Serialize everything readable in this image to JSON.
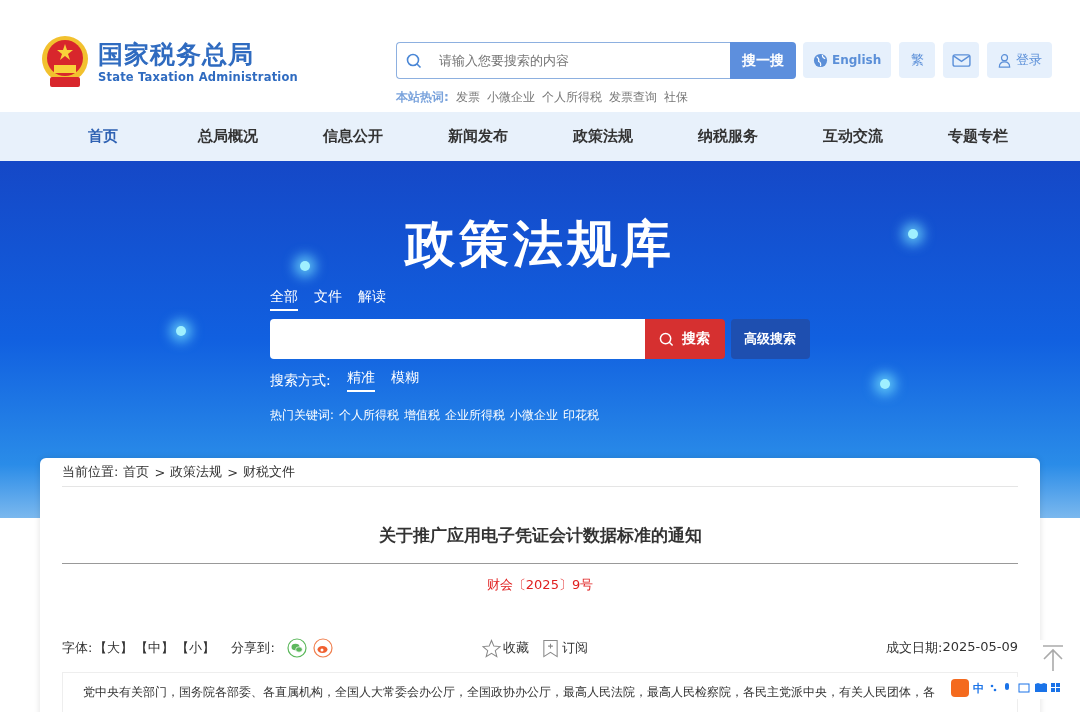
{
  "header": {
    "logo_title": "国家税务总局",
    "logo_subtitle": "State Taxation Administration",
    "search": {
      "placeholder": "请输入您要搜索的内容",
      "button": "搜一搜"
    },
    "hot_label": "本站热词:",
    "hot_words": [
      "发票",
      "小微企业",
      "个人所得税",
      "发票查询",
      "社保"
    ],
    "tools": [
      {
        "kind": "english",
        "label": "English"
      },
      {
        "kind": "text",
        "label": "繁"
      },
      {
        "kind": "mail"
      },
      {
        "kind": "login",
        "label": "登录"
      }
    ]
  },
  "nav": [
    {
      "label": "首页",
      "selected": true
    },
    {
      "label": "总局概况",
      "selected": false
    },
    {
      "label": "信息公开",
      "selected": false
    },
    {
      "label": "新闻发布",
      "selected": false
    },
    {
      "label": "政策法规",
      "selected": false
    },
    {
      "label": "纳税服务",
      "selected": false
    },
    {
      "label": "互动交流",
      "selected": false
    },
    {
      "label": "专题专栏",
      "selected": false
    }
  ],
  "banner": {
    "title": "政策法规库",
    "scope_tabs": [
      {
        "label": "全部",
        "selected": true
      },
      {
        "label": "文件",
        "selected": false
      },
      {
        "label": "解读",
        "selected": false
      }
    ],
    "search_button": "搜索",
    "advanced_button": "高级搜索",
    "mode_label": "搜索方式:",
    "modes": [
      {
        "label": "精准",
        "selected": true
      },
      {
        "label": "模糊",
        "selected": false
      }
    ],
    "keywords_label": "热门关键词:",
    "keywords": [
      "个人所得税",
      "增值税",
      "企业所得税",
      "小微企业",
      "印花税"
    ]
  },
  "breadcrumb": {
    "label": "当前位置:",
    "separator": ">",
    "items": [
      "首页",
      "政策法规",
      "财税文件"
    ]
  },
  "article": {
    "title": "关于推广应用电子凭证会计数据标准的通知",
    "doc_number": "财会〔2025〕9号",
    "font_label": "字体:",
    "font_sizes": [
      "【大】",
      "【中】",
      "【小】"
    ],
    "share_label": "分享到:",
    "favorite": "收藏",
    "subscribe": "订阅",
    "date_label": "成文日期:",
    "date": "2025-05-09",
    "body": "党中央有关部门，国务院各部委、各直属机构，全国人大常委会办公厅，全国政协办公厅，最高人民法院，最高人民检察院，各民主党派中央，有关人民团体，各"
  },
  "ime_bar": {
    "mode": "中"
  }
}
